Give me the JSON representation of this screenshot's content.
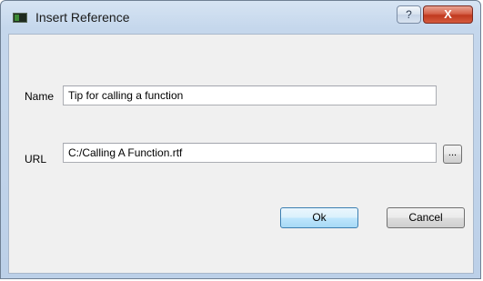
{
  "window": {
    "title": "Insert Reference",
    "help_label": "?",
    "close_label": "X"
  },
  "form": {
    "name_label": "Name",
    "name_value": "Tip for calling a function",
    "url_label": "URL",
    "url_value": "C:/Calling A Function.rtf",
    "browse_label": "..."
  },
  "buttons": {
    "ok_label": "Ok",
    "cancel_label": "Cancel"
  }
}
